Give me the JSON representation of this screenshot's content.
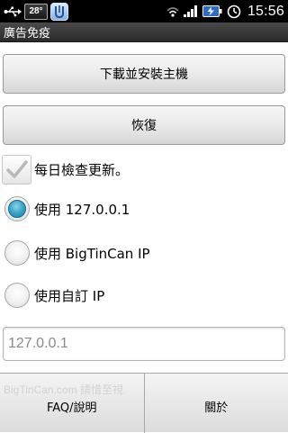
{
  "status_bar": {
    "icons": [
      "usb-icon",
      "weather-icon",
      "app-notification-icon",
      "wifi-icon",
      "signal-icon",
      "battery-charging-icon",
      "alarm-clock-icon"
    ],
    "temperature": "28°",
    "time": "15:56"
  },
  "title_bar": {
    "title": "廣告免疫"
  },
  "main": {
    "install_button_label": "下載並安裝主機",
    "restore_button_label": "恢復",
    "daily_update_checkbox": {
      "label": "每日檢查更新。",
      "checked": true
    },
    "radio_options": [
      {
        "label": "使用 127.0.0.1",
        "selected": true
      },
      {
        "label": "使用 BigTinCan IP",
        "selected": false
      },
      {
        "label": "使用自訂 IP",
        "selected": false
      }
    ],
    "custom_ip_input": {
      "value": "127.0.0.1"
    }
  },
  "bottom_bar": {
    "watermark": "BigTinCan.com 請惜至視",
    "faq_label": "FAQ/說明",
    "about_label": "關於"
  },
  "colors": {
    "radio_selected": "#2f97c1",
    "status_bar_bg": "#000000",
    "title_bar_bg": "#3a3a3a"
  }
}
